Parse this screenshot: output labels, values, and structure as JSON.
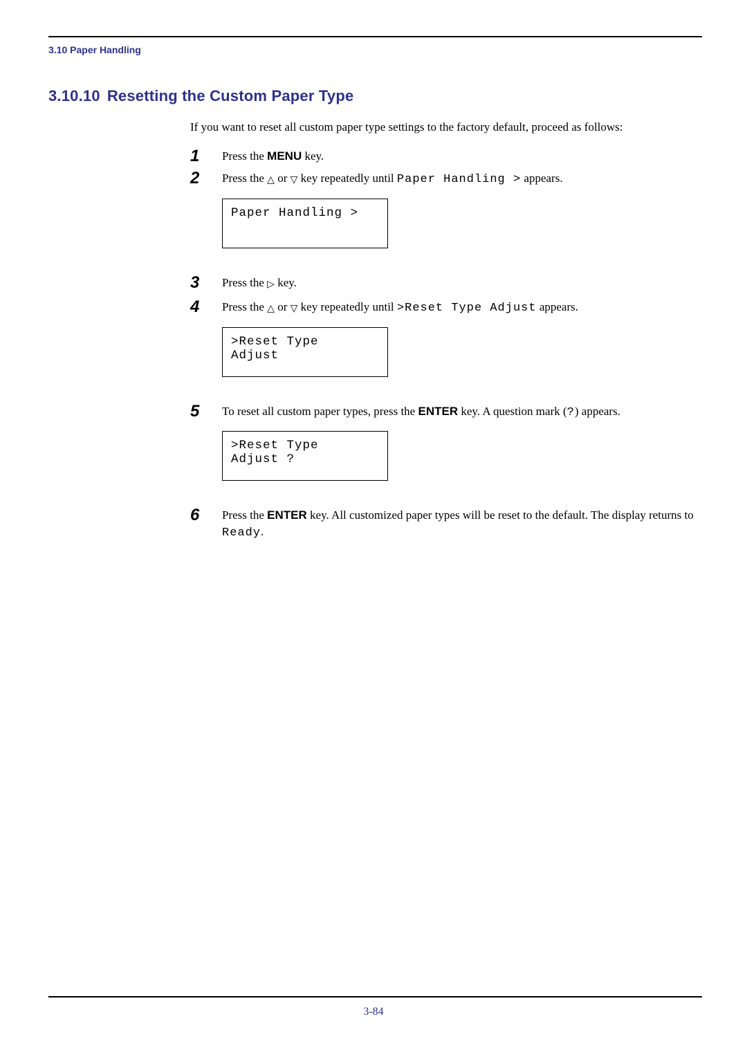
{
  "header": {
    "running": "3.10 Paper Handling"
  },
  "section": {
    "number": "3.10.10",
    "title": "Resetting the Custom Paper Type"
  },
  "intro": "If you want to reset all custom paper type settings to the factory default, proceed as follows:",
  "steps": {
    "s1": {
      "num": "1",
      "a": "Press the ",
      "key": "MENU",
      "b": " key."
    },
    "s2": {
      "num": "2",
      "a": "Press the ",
      "b": " or ",
      "c": " key repeatedly until ",
      "mono": "Paper Handling >",
      "d": " appears.",
      "lcd": "Paper Handling >"
    },
    "s3": {
      "num": "3",
      "a": "Press the ",
      "b": " key."
    },
    "s4": {
      "num": "4",
      "a": "Press the ",
      "b": " or ",
      "c": " key repeatedly until ",
      "mono": ">Reset Type Adjust",
      "d": " appears.",
      "lcd": ">Reset Type\nAdjust"
    },
    "s5": {
      "num": "5",
      "a": "To reset all custom paper types, press the ",
      "key": "ENTER",
      "b": " key. A question mark (",
      "mono": "?",
      "c": ") appears.",
      "lcd": ">Reset Type\nAdjust ?"
    },
    "s6": {
      "num": "6",
      "a": "Press the ",
      "key": "ENTER",
      "b": " key. All customized paper types will be reset to the default. The display returns to ",
      "mono": "Ready",
      "c": "."
    }
  },
  "footer": {
    "page": "3-84"
  }
}
